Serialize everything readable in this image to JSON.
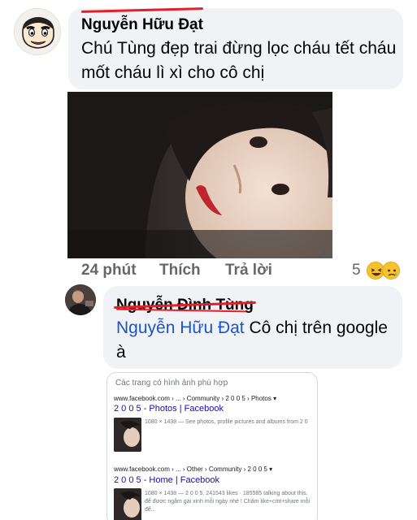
{
  "comment": {
    "author": "Nguyễn Hữu Đạt",
    "text": "Chú Tùng đẹp trai đừng lọc cháu tết cháu mốt cháu lì xì cho cô chị",
    "time": "24 phút",
    "like_label": "Thích",
    "reply_label": "Trả lời",
    "reaction_count": "5",
    "reactions": [
      "haha-emoji",
      "sad-emoji"
    ]
  },
  "reply": {
    "author": "Nguyễn Đình Tùng",
    "mention": "Nguyễn Hữu Đạt",
    "text": "Cô chị trên google à"
  },
  "search_card": {
    "header": "Các trang có hình ảnh phù hợp",
    "results": [
      {
        "url": "www.facebook.com › ... › Community › 2 0 0 5 › Photos ▾",
        "title": "2 0 0 5 - Photos | Facebook",
        "desc": [
          "1080 × 1438 — See photos, profile pictures and albums from 2 0"
        ]
      },
      {
        "url": "www.facebook.com › ... › Other › Community › 2 0 0 5 ▾",
        "title": "2 0 0 5 - Home | Facebook",
        "desc": [
          "1080 × 1438 — 2 0 0 5. 241543 likes · 185585 talking about this.",
          "để được ngắm gái xinh mỗi ngày nhé ! Chăm like+cmt+share mỗi",
          "để..."
        ]
      }
    ]
  },
  "colors": {
    "bubble": "#f0f2f5",
    "mention": "#1a55c8",
    "meta": "#65676b",
    "strike": "#e0202a"
  }
}
